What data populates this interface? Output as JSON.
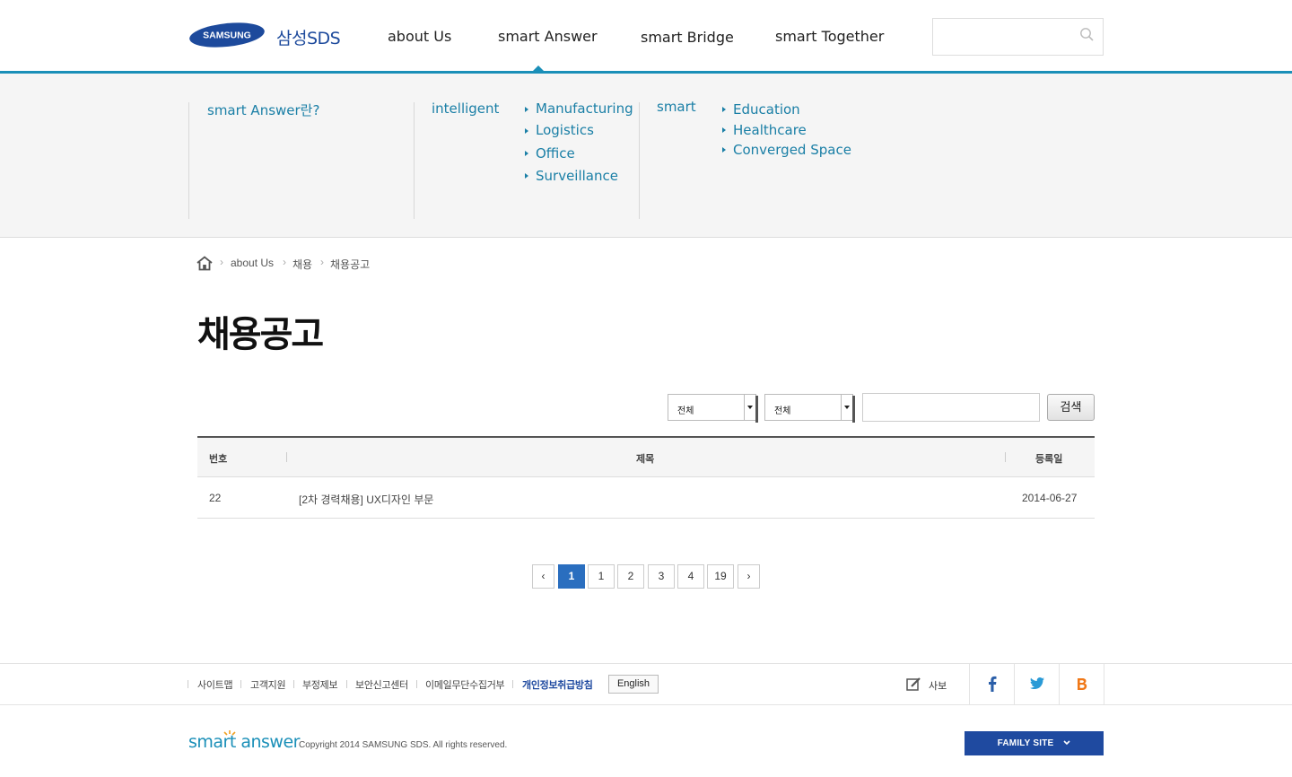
{
  "header": {
    "logo_samsung": "SAMSUNG",
    "logo_sds": "삼성SDS",
    "nav": [
      "about Us",
      "smart Answer",
      "smart Bridge",
      "smart Together"
    ],
    "active_nav": "smart Answer"
  },
  "mega_menu": {
    "col1": "smart Answer란?",
    "col2_heading": "intelligent",
    "col2_items": [
      "Manufacturing",
      "Logistics",
      "Office",
      "Surveillance"
    ],
    "col3_heading": "smart",
    "col3_items": [
      "Education",
      "Healthcare",
      "Converged Space"
    ]
  },
  "breadcrumb": [
    "about Us",
    "채용",
    "채용공고"
  ],
  "page_title": "채용공고",
  "filters": {
    "select1": "전체",
    "select2": "전체",
    "search_value": "",
    "search_button": "검색"
  },
  "table": {
    "headers": [
      "번호",
      "제목",
      "등록일"
    ],
    "rows": [
      {
        "no": "22",
        "title": "[2차 경력채용] UX디자인 부문",
        "date": "2014-06-27"
      }
    ]
  },
  "pagination": {
    "prev": "‹",
    "pages": [
      "1",
      "1",
      "2",
      "3",
      "4",
      "19"
    ],
    "active_index": 0,
    "next": "›"
  },
  "footer": {
    "links": [
      "사이트맵",
      "고객지원",
      "부정제보",
      "보안신고센터",
      "이메일무단수집거부",
      "개인정보취급방침"
    ],
    "english": "English",
    "sabo": "사보",
    "sns": [
      "facebook-icon",
      "twitter-icon",
      "blog-icon"
    ],
    "logo": "smart answer",
    "copyright": "Copyright 2014 SAMSUNG SDS. All rights reserved.",
    "family_site": "FAMILY SITE"
  },
  "colors": {
    "accent": "#1a8fb8",
    "link": "#1a7fa6",
    "pagination_active": "#2a6ebf",
    "family_site_bg": "#1f4aa0"
  }
}
